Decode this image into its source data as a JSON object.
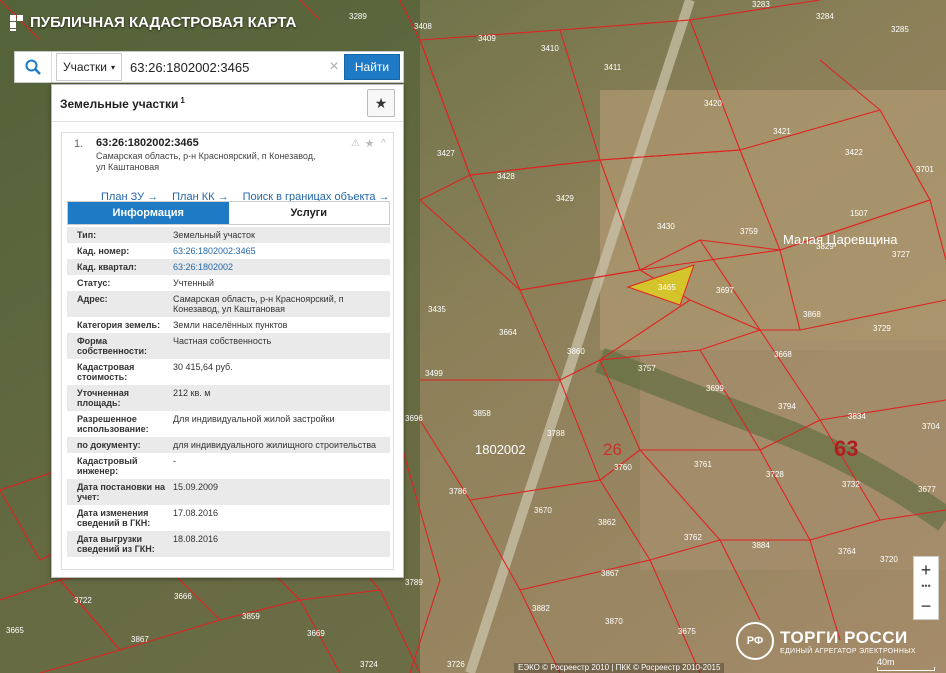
{
  "app": {
    "title": "ПУБЛИЧНАЯ КАДАСТРОВАЯ КАРТА"
  },
  "search": {
    "type_label": "Участки",
    "query": "63:26:1802002:3465",
    "find_label": "Найти"
  },
  "panel": {
    "title": "Земельные участки",
    "count": "1",
    "result": {
      "index": "1.",
      "cad_number": "63:26:1802002:3465",
      "address": "Самарская область, р-н Красноярский, п Конезавод, ул Каштановая",
      "links": [
        "План ЗУ →",
        "План КК →",
        "Поиск в границах объекта →"
      ]
    },
    "tabs": [
      "Информация",
      "Услуги"
    ],
    "info": [
      {
        "label": "Тип:",
        "value": "Земельный участок"
      },
      {
        "label": "Кад. номер:",
        "value": "63:26:1802002:3465",
        "link": true
      },
      {
        "label": "Кад. квартал:",
        "value": "63:26:1802002",
        "link": true
      },
      {
        "label": "Статус:",
        "value": "Учтенный"
      },
      {
        "label": "Адрес:",
        "value": "Самарская область, р-н Красноярский, п Конезавод, ул Каштановая"
      },
      {
        "label": "Категория земель:",
        "value": "Земли населённых пунктов"
      },
      {
        "label": "Форма собственности:",
        "value": "Частная собственность"
      },
      {
        "label": "Кадастровая стоимость:",
        "value": "30 415,64 руб."
      },
      {
        "label": "Уточненная площадь:",
        "value": "212 кв. м"
      },
      {
        "label": "Разрешенное использование:",
        "value": "Для индивидуальной жилой застройки"
      },
      {
        "label": "по документу:",
        "value": "для индивидуального жилищного строительства"
      },
      {
        "label": "Кадастровый инженер:",
        "value": "-"
      },
      {
        "label": "Дата постановки на учет:",
        "value": "15.09.2009"
      },
      {
        "label": "Дата изменения сведений в ГКН:",
        "value": "17.08.2016"
      },
      {
        "label": "Дата выгрузки сведений из ГКН:",
        "value": "18.08.2016"
      }
    ]
  },
  "map": {
    "parcel_labels": [
      {
        "text": "3289"
      },
      {
        "text": "3408"
      },
      {
        "text": "3409"
      },
      {
        "text": "3410"
      },
      {
        "text": "3411"
      },
      {
        "text": "3283"
      },
      {
        "text": "3284"
      },
      {
        "text": "3285"
      },
      {
        "text": "3420"
      },
      {
        "text": "3421"
      },
      {
        "text": "3422"
      },
      {
        "text": "3701"
      },
      {
        "text": "3427"
      },
      {
        "text": "3428"
      },
      {
        "text": "3429"
      },
      {
        "text": "3430"
      },
      {
        "text": "3759"
      },
      {
        "text": "3829"
      },
      {
        "text": "3727"
      },
      {
        "text": "1507"
      },
      {
        "text": "3465"
      },
      {
        "text": "3697"
      },
      {
        "text": "3868"
      },
      {
        "text": "3729"
      },
      {
        "text": "3435"
      },
      {
        "text": "3664"
      },
      {
        "text": "3860"
      },
      {
        "text": "3668"
      },
      {
        "text": "3757"
      },
      {
        "text": "3699"
      },
      {
        "text": "3794"
      },
      {
        "text": "3834"
      },
      {
        "text": "3499"
      },
      {
        "text": "3858"
      },
      {
        "text": "3696"
      },
      {
        "text": "3788"
      },
      {
        "text": "3761"
      },
      {
        "text": "3760"
      },
      {
        "text": "3728"
      },
      {
        "text": "3732"
      },
      {
        "text": "3704"
      },
      {
        "text": "3786"
      },
      {
        "text": "3670"
      },
      {
        "text": "3862"
      },
      {
        "text": "3677"
      },
      {
        "text": "3762"
      },
      {
        "text": "3884"
      },
      {
        "text": "3764"
      },
      {
        "text": "3867"
      },
      {
        "text": "3789"
      },
      {
        "text": "3722"
      },
      {
        "text": "3666"
      },
      {
        "text": "3882"
      },
      {
        "text": "3859"
      },
      {
        "text": "3870"
      },
      {
        "text": "3665"
      },
      {
        "text": "3669"
      },
      {
        "text": "3675"
      },
      {
        "text": "3867"
      },
      {
        "text": "3724"
      },
      {
        "text": "3726"
      },
      {
        "text": "3720"
      }
    ],
    "place_name": "Малая Царевщина",
    "quarter_label": "1802002",
    "district_label": "26",
    "region_label": "63",
    "scale": "40m",
    "attribution": "ЕЭКО © Росреестр 2010 | ПКК © Росреестр 2010-2015"
  },
  "brand": {
    "name": "ТОРГИ РОССИ",
    "sub": "ЕДИНЫЙ АГРЕГАТОР ЭЛЕКТРОННЫХ",
    "emblem": "РФ"
  },
  "colors": {
    "accent": "#1e7ac4",
    "parcel_border": "#e02222",
    "selected_fill": "#e0d21e"
  }
}
